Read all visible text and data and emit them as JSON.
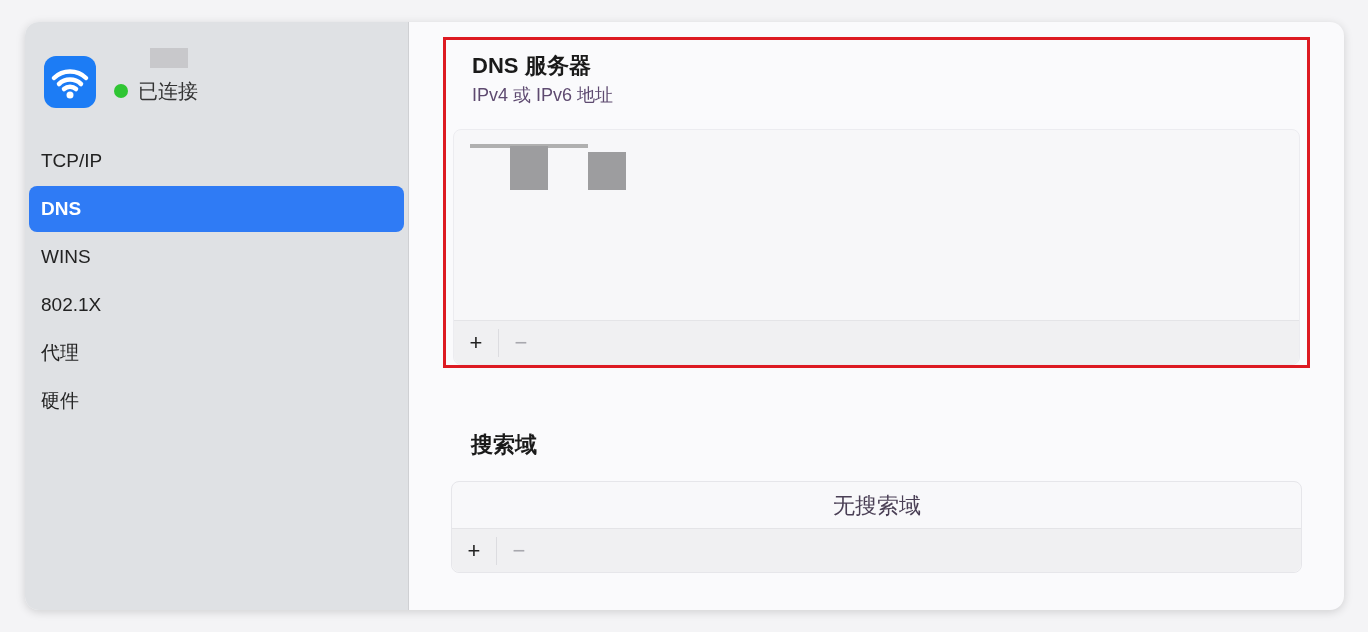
{
  "connection": {
    "status": "已连接",
    "connected": true
  },
  "sidebar": {
    "items": [
      {
        "label": "TCP/IP",
        "selected": false
      },
      {
        "label": "DNS",
        "selected": true
      },
      {
        "label": "WINS",
        "selected": false
      },
      {
        "label": "802.1X",
        "selected": false
      },
      {
        "label": "代理",
        "selected": false
      },
      {
        "label": "硬件",
        "selected": false
      }
    ]
  },
  "dns_servers": {
    "title": "DNS 服务器",
    "subtitle": "IPv4 或 IPv6 地址",
    "highlighted": true,
    "buttons": [
      {
        "label": "+",
        "disabled": false
      },
      {
        "label": "−",
        "disabled": true
      }
    ]
  },
  "search_domains": {
    "title": "搜索域",
    "empty_text": "无搜索域",
    "buttons": [
      {
        "label": "+",
        "disabled": false
      },
      {
        "label": "−",
        "disabled": true
      }
    ]
  }
}
